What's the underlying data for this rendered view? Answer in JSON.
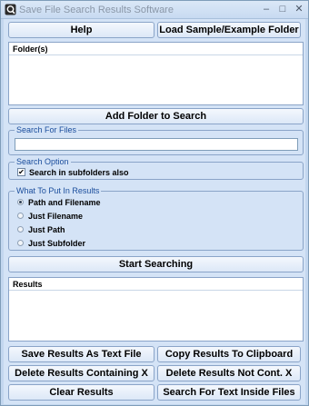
{
  "window": {
    "title": "Save File Search Results Software",
    "minimize_glyph": "–",
    "maximize_glyph": "□",
    "close_glyph": "✕"
  },
  "buttons": {
    "help": "Help",
    "load_sample": "Load Sample/Example Folder",
    "add_folder": "Add Folder to Search",
    "start_searching": "Start Searching",
    "save_results": "Save Results As Text File",
    "copy_results": "Copy Results To Clipboard",
    "delete_containing": "Delete Results Containing X",
    "delete_not_containing": "Delete Results Not Cont. X",
    "clear_results": "Clear Results",
    "search_inside_files": "Search For Text Inside Files"
  },
  "folders_panel": {
    "header": "Folder(s)"
  },
  "search_for_files": {
    "title": "Search For Files",
    "value": ""
  },
  "search_option": {
    "title": "Search Option",
    "subfolders_label": "Search in subfolders also",
    "subfolders_checked": true,
    "check_glyph": "✔"
  },
  "results_content": {
    "title": "What To Put In Results",
    "options": [
      {
        "label": "Path and Filename",
        "selected": true
      },
      {
        "label": "Just Filename",
        "selected": false
      },
      {
        "label": "Just Path",
        "selected": false
      },
      {
        "label": "Just Subfolder",
        "selected": false
      }
    ]
  },
  "results_panel": {
    "header": "Results"
  }
}
